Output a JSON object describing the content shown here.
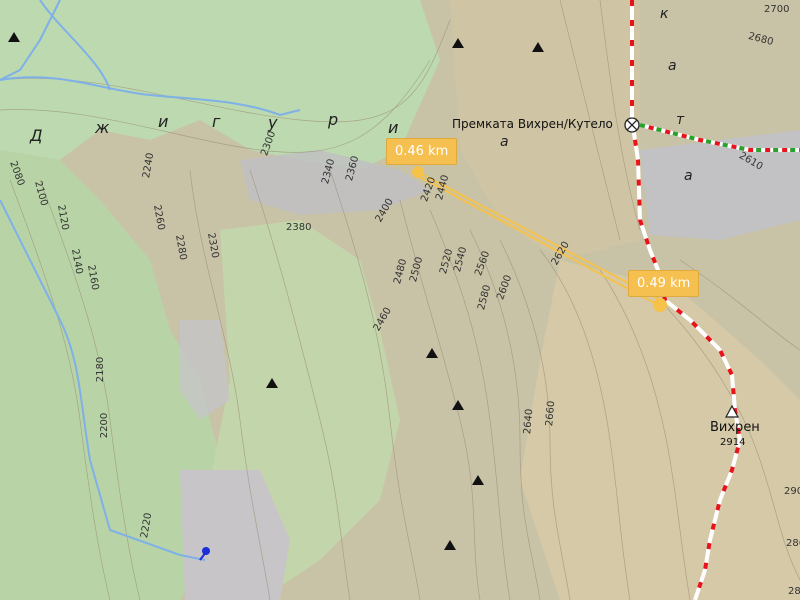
{
  "map": {
    "pass_name": "Премката Вихрен/Кутело",
    "peak": {
      "name": "Вихрен",
      "elevation": "2914"
    },
    "distance_labels": [
      "0.46 km",
      "0.49 km"
    ],
    "ridge_letters_left": [
      "Д",
      "ж",
      "и",
      "г",
      "у",
      "р",
      "и"
    ],
    "ridge_letters_right": [
      "к",
      "а",
      "т",
      "а"
    ],
    "ridge_letter_mid": "а",
    "contour_labels": [
      "2300",
      "2340",
      "2360",
      "2240",
      "2380",
      "2400",
      "2420",
      "2440",
      "2260",
      "2280",
      "2320",
      "2080",
      "2100",
      "2120",
      "2140",
      "2160",
      "2180",
      "2200",
      "2220",
      "2460",
      "2480",
      "2500",
      "2520",
      "2540",
      "2560",
      "2580",
      "2600",
      "2620",
      "2640",
      "2660",
      "2680",
      "2700",
      "2610",
      "290",
      "286",
      "28"
    ],
    "colors": {
      "route": "#e8121a",
      "route_green": "#2aa12a",
      "river": "#7fb0e8",
      "measure_line": "#f6c24a",
      "forest": "#b4d6a8",
      "scree": "#bdbdc0",
      "terrain": "#d6c9a6"
    },
    "icons": [
      "peak-icon",
      "triangle-peak-icon",
      "pass-icon",
      "location-pin-icon"
    ]
  }
}
